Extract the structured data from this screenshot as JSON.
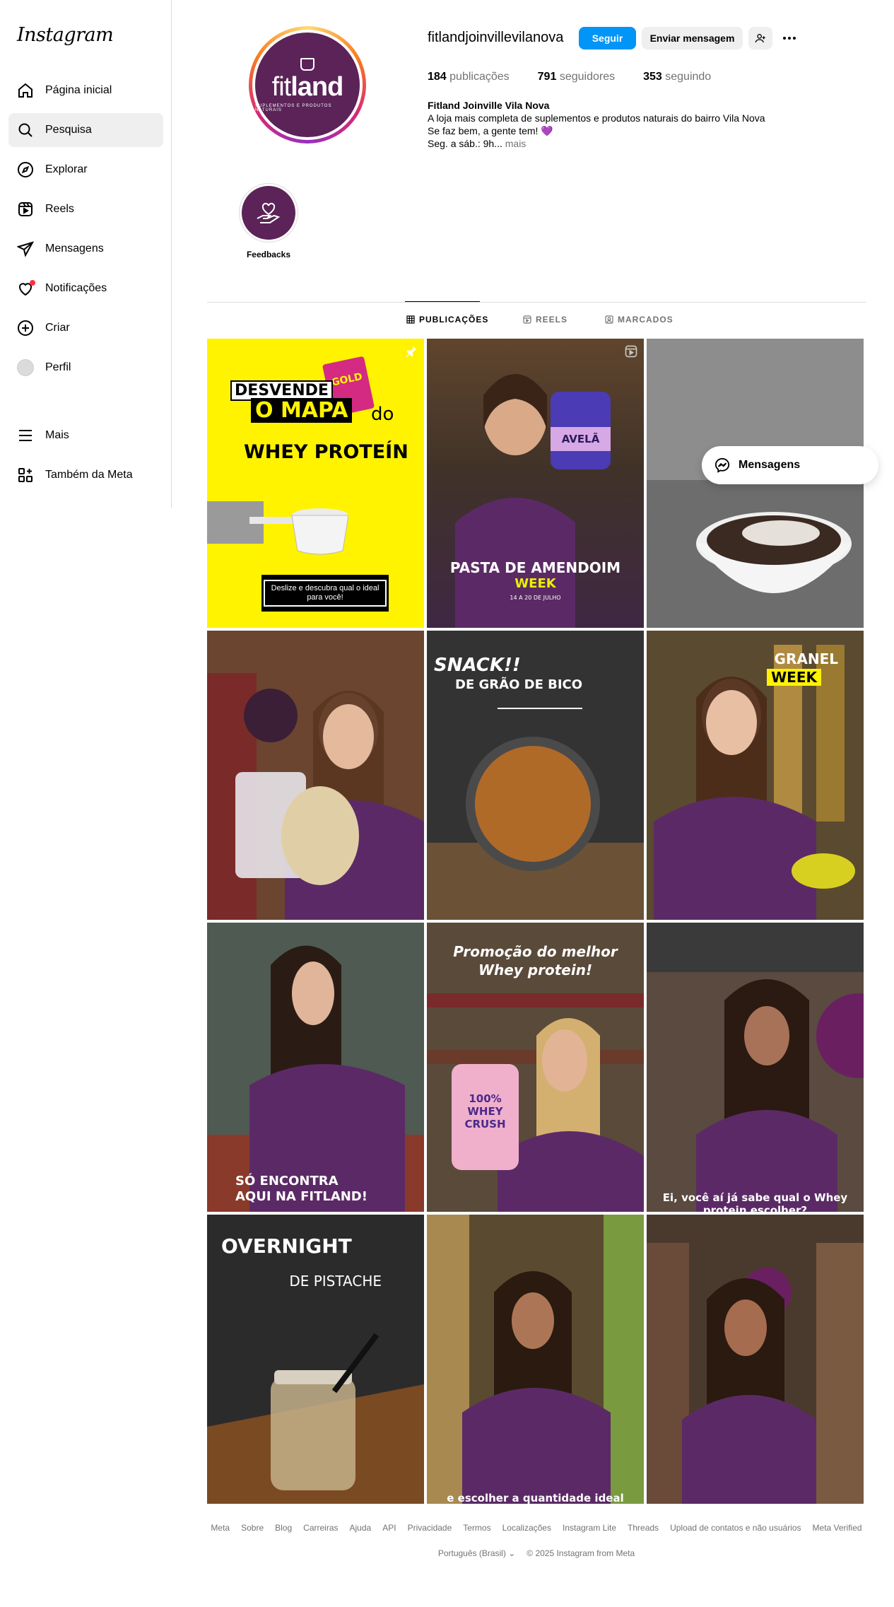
{
  "sidebar": {
    "logo": "Instagram",
    "items": [
      {
        "label": "Página inicial",
        "icon": "home-icon"
      },
      {
        "label": "Pesquisa",
        "icon": "search-icon"
      },
      {
        "label": "Explorar",
        "icon": "compass-icon"
      },
      {
        "label": "Reels",
        "icon": "reels-icon"
      },
      {
        "label": "Mensagens",
        "icon": "paper-plane-icon"
      },
      {
        "label": "Notificações",
        "icon": "heart-icon"
      },
      {
        "label": "Criar",
        "icon": "plus-square-icon"
      },
      {
        "label": "Perfil",
        "icon": "avatar"
      },
      {
        "label": "Mais",
        "icon": "menu-icon"
      },
      {
        "label": "Também da Meta",
        "icon": "grid-icon"
      }
    ],
    "active_item": "Pesquisa"
  },
  "profile": {
    "username": "fitlandjoinvillevilanova",
    "follow_label": "Seguir",
    "message_label": "Enviar mensagem",
    "stats": {
      "posts_count": "184",
      "posts_label": "publicações",
      "followers_count": "791",
      "followers_label": "seguidores",
      "following_count": "353",
      "following_label": "seguindo"
    },
    "bio": {
      "name": "Fitland Joinville Vila Nova",
      "line1": "A loja mais completa de suplementos e produtos naturais do bairro Vila Nova",
      "line2": "Se faz bem, a gente tem! 💜",
      "line3": "Seg. a sáb.: 9h...",
      "more": "mais"
    },
    "avatar_brand": {
      "word_light": "fit",
      "word_bold": "land",
      "sub": "SUPLEMENTOS E PRODUTOS NATURAIS"
    }
  },
  "highlights": [
    {
      "label": "Feedbacks"
    }
  ],
  "tabs": [
    {
      "label": "PUBLICAÇÕES",
      "active": true
    },
    {
      "label": "REELS",
      "active": false
    },
    {
      "label": "MARCADOS",
      "active": false
    }
  ],
  "posts": {
    "p1": {
      "pack": "GOLD",
      "line1": "DESVENDE",
      "line2": "O MAPA",
      "line2b": "do",
      "line3": "WHEY PROTEÍN",
      "cta": "Deslize e descubra qual o ideal para você!"
    },
    "p2": {
      "tub": "AVELÃ",
      "title": "PASTA DE AMENDOIM",
      "week": "WEEK",
      "date": "14 A 20 DE JULHO"
    },
    "p5": {
      "line1": "SNACK!!",
      "line2": "DE GRÃO DE BICO"
    },
    "p6": {
      "line1": "GRANEL",
      "line2": "WEEK"
    },
    "p7": {
      "caption": "SÓ ENCONTRA AQUI NA FITLAND!"
    },
    "p8": {
      "title": "Promoção do melhor Whey protein!",
      "jar": "100% WHEY CRUSH"
    },
    "p9": {
      "caption": "Ei, você aí já sabe qual o Whey protein escolher?"
    },
    "p10": {
      "line1": "OVERNIGHT",
      "line2": "DE PISTACHE"
    },
    "p11": {
      "caption": "e escolher a quantidade ideal"
    }
  },
  "messages_float": {
    "label": "Mensagens"
  },
  "footer": {
    "links": [
      "Meta",
      "Sobre",
      "Blog",
      "Carreiras",
      "Ajuda",
      "API",
      "Privacidade",
      "Termos",
      "Localizações",
      "Instagram Lite",
      "Threads",
      "Upload de contatos e não usuários",
      "Meta Verified"
    ],
    "language": "Português (Brasil)",
    "copyright": "© 2025 Instagram from Meta"
  },
  "colors": {
    "accent": "#0095f6",
    "brand_purple": "#5b2358",
    "notification_dot": "#ff3040",
    "p1_yellow": "#fff300"
  }
}
